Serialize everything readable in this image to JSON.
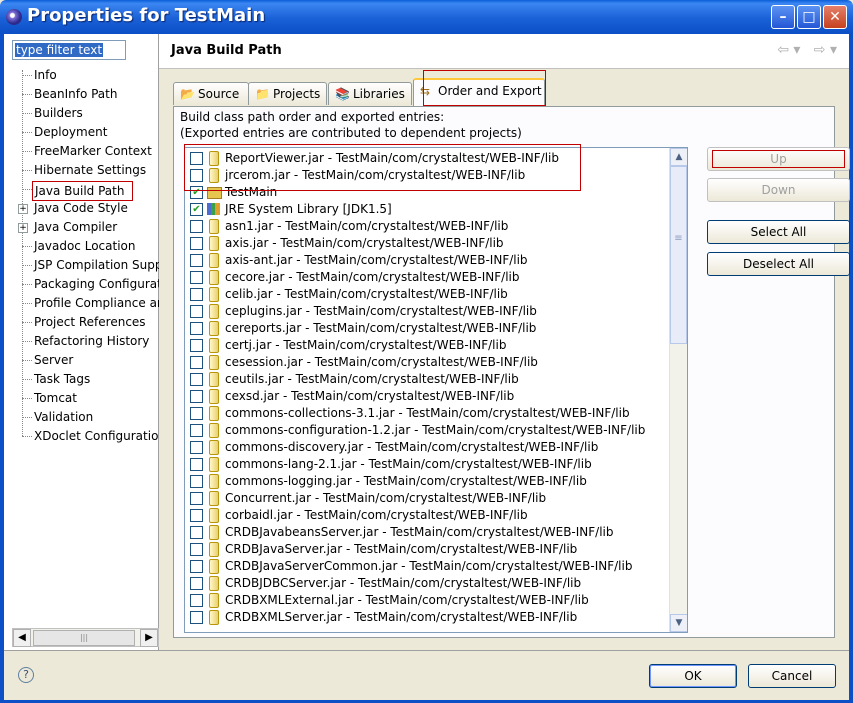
{
  "window": {
    "title": "Properties for TestMain"
  },
  "filter": {
    "value": "type filter text"
  },
  "sidebar": {
    "items": [
      {
        "label": "Info"
      },
      {
        "label": "BeanInfo Path"
      },
      {
        "label": "Builders"
      },
      {
        "label": "Deployment"
      },
      {
        "label": "FreeMarker Context"
      },
      {
        "label": "Hibernate Settings"
      },
      {
        "label": "Java Build Path"
      },
      {
        "label": "Java Code Style"
      },
      {
        "label": "Java Compiler"
      },
      {
        "label": "Javadoc Location"
      },
      {
        "label": "JSP Compilation Supp"
      },
      {
        "label": "Packaging Configurat"
      },
      {
        "label": "Profile Compliance ar"
      },
      {
        "label": "Project References"
      },
      {
        "label": "Refactoring History"
      },
      {
        "label": "Server"
      },
      {
        "label": "Task Tags"
      },
      {
        "label": "Tomcat"
      },
      {
        "label": "Validation"
      },
      {
        "label": "XDoclet Configuratior"
      }
    ],
    "selected": "Java Build Path"
  },
  "page": {
    "title": "Java Build Path"
  },
  "tabs": [
    {
      "label": "Source"
    },
    {
      "label": "Projects"
    },
    {
      "label": "Libraries"
    },
    {
      "label": "Order and Export"
    }
  ],
  "active_tab": "Order and Export",
  "description": {
    "line1": "Build class path order and exported entries:",
    "line2": "(Exported entries are contributed to dependent projects)"
  },
  "entries": [
    {
      "label": "ReportViewer.jar - TestMain/com/crystaltest/WEB-INF/lib",
      "checked": false,
      "kind": "jar"
    },
    {
      "label": "jrcerom.jar - TestMain/com/crystaltest/WEB-INF/lib",
      "checked": false,
      "kind": "jar"
    },
    {
      "label": "TestMain",
      "checked": true,
      "kind": "project"
    },
    {
      "label": "JRE System Library [JDK1.5]",
      "checked": true,
      "kind": "library"
    },
    {
      "label": "asn1.jar - TestMain/com/crystaltest/WEB-INF/lib",
      "checked": false,
      "kind": "jar"
    },
    {
      "label": "axis.jar - TestMain/com/crystaltest/WEB-INF/lib",
      "checked": false,
      "kind": "jar"
    },
    {
      "label": "axis-ant.jar - TestMain/com/crystaltest/WEB-INF/lib",
      "checked": false,
      "kind": "jar"
    },
    {
      "label": "cecore.jar - TestMain/com/crystaltest/WEB-INF/lib",
      "checked": false,
      "kind": "jar"
    },
    {
      "label": "celib.jar - TestMain/com/crystaltest/WEB-INF/lib",
      "checked": false,
      "kind": "jar"
    },
    {
      "label": "ceplugins.jar - TestMain/com/crystaltest/WEB-INF/lib",
      "checked": false,
      "kind": "jar"
    },
    {
      "label": "cereports.jar - TestMain/com/crystaltest/WEB-INF/lib",
      "checked": false,
      "kind": "jar"
    },
    {
      "label": "certj.jar - TestMain/com/crystaltest/WEB-INF/lib",
      "checked": false,
      "kind": "jar"
    },
    {
      "label": "cesession.jar - TestMain/com/crystaltest/WEB-INF/lib",
      "checked": false,
      "kind": "jar"
    },
    {
      "label": "ceutils.jar - TestMain/com/crystaltest/WEB-INF/lib",
      "checked": false,
      "kind": "jar"
    },
    {
      "label": "cexsd.jar - TestMain/com/crystaltest/WEB-INF/lib",
      "checked": false,
      "kind": "jar"
    },
    {
      "label": "commons-collections-3.1.jar - TestMain/com/crystaltest/WEB-INF/lib",
      "checked": false,
      "kind": "jar"
    },
    {
      "label": "commons-configuration-1.2.jar - TestMain/com/crystaltest/WEB-INF/lib",
      "checked": false,
      "kind": "jar"
    },
    {
      "label": "commons-discovery.jar - TestMain/com/crystaltest/WEB-INF/lib",
      "checked": false,
      "kind": "jar"
    },
    {
      "label": "commons-lang-2.1.jar - TestMain/com/crystaltest/WEB-INF/lib",
      "checked": false,
      "kind": "jar"
    },
    {
      "label": "commons-logging.jar - TestMain/com/crystaltest/WEB-INF/lib",
      "checked": false,
      "kind": "jar"
    },
    {
      "label": "Concurrent.jar - TestMain/com/crystaltest/WEB-INF/lib",
      "checked": false,
      "kind": "jar"
    },
    {
      "label": "corbaidl.jar - TestMain/com/crystaltest/WEB-INF/lib",
      "checked": false,
      "kind": "jar"
    },
    {
      "label": "CRDBJavabeansServer.jar - TestMain/com/crystaltest/WEB-INF/lib",
      "checked": false,
      "kind": "jar"
    },
    {
      "label": "CRDBJavaServer.jar - TestMain/com/crystaltest/WEB-INF/lib",
      "checked": false,
      "kind": "jar"
    },
    {
      "label": "CRDBJavaServerCommon.jar - TestMain/com/crystaltest/WEB-INF/lib",
      "checked": false,
      "kind": "jar"
    },
    {
      "label": "CRDBJDBCServer.jar - TestMain/com/crystaltest/WEB-INF/lib",
      "checked": false,
      "kind": "jar"
    },
    {
      "label": "CRDBXMLExternal.jar - TestMain/com/crystaltest/WEB-INF/lib",
      "checked": false,
      "kind": "jar"
    },
    {
      "label": "CRDBXMLServer.jar - TestMain/com/crystaltest/WEB-INF/lib",
      "checked": false,
      "kind": "jar"
    }
  ],
  "side_buttons": {
    "up": "Up",
    "down": "Down",
    "select_all": "Select All",
    "deselect_all": "Deselect All"
  },
  "footer": {
    "ok": "OK",
    "cancel": "Cancel"
  },
  "colors": {
    "titlebar": "#0c4fc6",
    "highlight_box": "#c00000",
    "selection": "#316ac5"
  }
}
